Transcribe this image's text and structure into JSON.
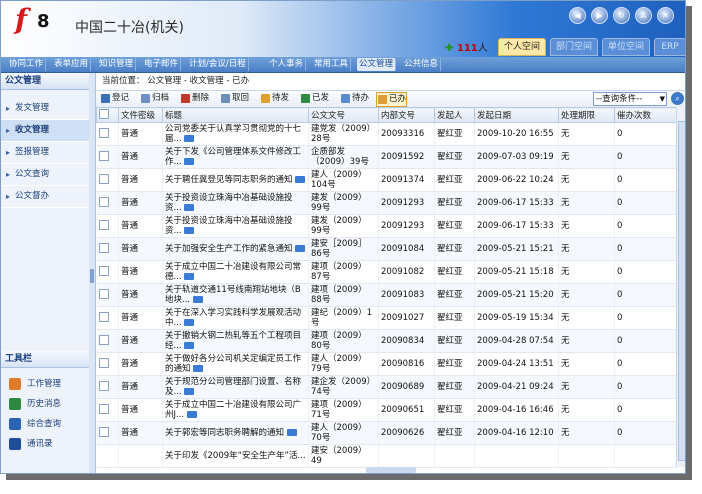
{
  "app": {
    "title": "中国二十冶(机关)",
    "logo_text": "f8"
  },
  "online": {
    "count": "111",
    "unit": "人"
  },
  "header_tabs": [
    {
      "label": "个人空间",
      "active": true
    },
    {
      "label": "部门空间",
      "active": false
    },
    {
      "label": "单位空间",
      "active": false
    },
    {
      "label": "ERP",
      "active": false
    }
  ],
  "menu": [
    "协同工作",
    "表单应用",
    "知识管理",
    "电子邮件",
    "计划/会议/日程",
    "个人事务",
    "常用工具",
    "公文管理",
    "公共信息"
  ],
  "menu_active": "公文管理",
  "sidebar": {
    "title": "公文管理",
    "items": [
      {
        "label": "发文管理"
      },
      {
        "label": "收文管理"
      },
      {
        "label": "签报管理"
      },
      {
        "label": "公文查询"
      },
      {
        "label": "公文督办"
      }
    ],
    "tools_title": "工具栏",
    "tools": [
      {
        "label": "工作管理",
        "icon": "work-icon",
        "color": "#e07b2a"
      },
      {
        "label": "历史消息",
        "icon": "history-icon",
        "color": "#2b8a3e"
      },
      {
        "label": "综合查询",
        "icon": "query-icon",
        "color": "#2d63b5"
      },
      {
        "label": "通讯录",
        "icon": "contacts-icon",
        "color": "#1f4f9a"
      }
    ]
  },
  "breadcrumb": "当前位置： 公文管理 - 收文管理 - 已办",
  "toolbar": {
    "buttons": [
      {
        "label": "登记",
        "color": "#3a6fb8"
      },
      {
        "label": "归档",
        "color": "#6d8fc2"
      },
      {
        "label": "删除",
        "color": "#c0392b"
      },
      {
        "label": "取回",
        "color": "#6b8fb8"
      },
      {
        "label": "待发",
        "color": "#e0a030"
      },
      {
        "label": "已发",
        "color": "#2e8b3f"
      },
      {
        "label": "待办",
        "color": "#5a8ad0"
      },
      {
        "label": "已办",
        "color": "#e0a030",
        "active": true
      }
    ],
    "query_placeholder": "--查询条件--"
  },
  "table": {
    "columns": [
      "",
      "文件密级",
      "标题",
      "公文文号",
      "内部文号",
      "发起人",
      "发起日期",
      "处理期限",
      "催办次数"
    ],
    "rows": [
      [
        "普通",
        "公司党委关于认真学习贯彻党的十七届...",
        "建党发（2009）28号",
        "20093316",
        "翟红亚",
        "2009-10-20 16:55",
        "无",
        "0"
      ],
      [
        "普通",
        "关于下发《公司管理体系文件修改工作...",
        "企质部发（2009）39号",
        "20091592",
        "翟红亚",
        "2009-07-03 09:19",
        "无",
        "0"
      ],
      [
        "普通",
        "关于聘任冀登见等同志职务的通知",
        "建人（2009）104号",
        "20091374",
        "翟红亚",
        "2009-06-22 10:24",
        "无",
        "0"
      ],
      [
        "普通",
        "关于投资设立珠海中冶基础设施投资...",
        "建发（2009）99号",
        "20091293",
        "翟红亚",
        "2009-06-17 15:33",
        "无",
        "0"
      ],
      [
        "普通",
        "关于投资设立珠海中冶基础设施投资...",
        "建发（2009）99号",
        "20091293",
        "翟红亚",
        "2009-06-17 15:33",
        "无",
        "0"
      ],
      [
        "普通",
        "关于加强安全生产工作的紧急通知",
        "建安［2009］86号",
        "20091084",
        "翟红亚",
        "2009-05-21 15:21",
        "无",
        "0"
      ],
      [
        "普通",
        "关于成立中国二十冶建设有限公司常德...",
        "建项（2009）87号",
        "20091082",
        "翟红亚",
        "2009-05-21 15:18",
        "无",
        "0"
      ],
      [
        "普通",
        "关于轨道交通11号线南翔站地块（B地块...",
        "建项（2009）88号",
        "20091083",
        "翟红亚",
        "2009-05-21 15:20",
        "无",
        "0"
      ],
      [
        "普通",
        "关于在深入学习实践科学发展观活动中...",
        "建纪（2009）1号",
        "20091027",
        "翟红亚",
        "2009-05-19 15:34",
        "无",
        "0"
      ],
      [
        "普通",
        "关于撤销大钢二热轧等五个工程项目经...",
        "建项（2009）80号",
        "20090834",
        "翟红亚",
        "2009-04-28 07:54",
        "无",
        "0"
      ],
      [
        "普通",
        "关于做好各分公司机关定编定员工作的通知",
        "建人（2009）79号",
        "20090816",
        "翟红亚",
        "2009-04-24 13:51",
        "无",
        "0"
      ],
      [
        "普通",
        "关于规范分公司管理部门设置、名称及...",
        "建企发（2009）74号",
        "20090689",
        "翟红亚",
        "2009-04-21 09:24",
        "无",
        "0"
      ],
      [
        "普通",
        "关于成立中国二十冶建设有限公司广州J...",
        "建项（2009）71号",
        "20090651",
        "翟红亚",
        "2009-04-16 16:46",
        "无",
        "0"
      ],
      [
        "普通",
        "关于郭宏等同志职务聘解的通知",
        "建人（2009）70号",
        "20090626",
        "翟红亚",
        "2009-04-16 12:10",
        "无",
        "0"
      ],
      [
        "",
        "关于印发《2009年“安全生产年”活...",
        "建安（2009）49",
        "",
        "",
        "",
        "",
        ""
      ]
    ]
  }
}
